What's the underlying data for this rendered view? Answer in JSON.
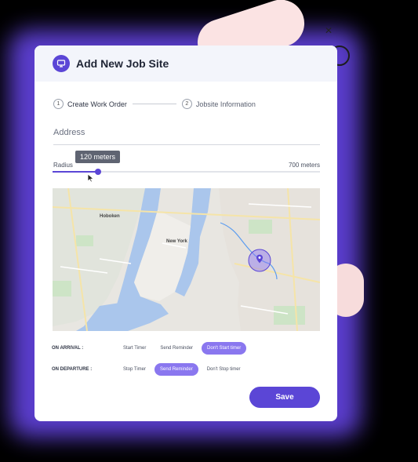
{
  "header": {
    "title": "Add New Job Site",
    "icon": "monitor-icon"
  },
  "steps": [
    {
      "number": "1",
      "label": "Create Work Order"
    },
    {
      "number": "2",
      "label": "Jobsite Information"
    }
  ],
  "address": {
    "placeholder": "Address"
  },
  "radius": {
    "label": "Radius",
    "max_label": "700 meters",
    "tooltip": "120 meters",
    "value_meters": 120,
    "max_meters": 700
  },
  "map": {
    "labels": [
      "Hoboken",
      "New York"
    ],
    "pin_icon": "location-pin-icon"
  },
  "on_arrival": {
    "label": "ON ARRIVAL :",
    "options": [
      "Start Timer",
      "Send Reminder",
      "Don't Start timer"
    ],
    "selected": "Don't Start timer"
  },
  "on_departure": {
    "label": "ON DEPARTURE :",
    "options": [
      "Stop Timer",
      "Send Reminder",
      "Don't Stop timer"
    ],
    "selected": "Send Reminder"
  },
  "save_label": "Save",
  "colors": {
    "accent": "#5b46d6",
    "accent_light": "#8a77ef",
    "glow": "#6a48f0"
  }
}
